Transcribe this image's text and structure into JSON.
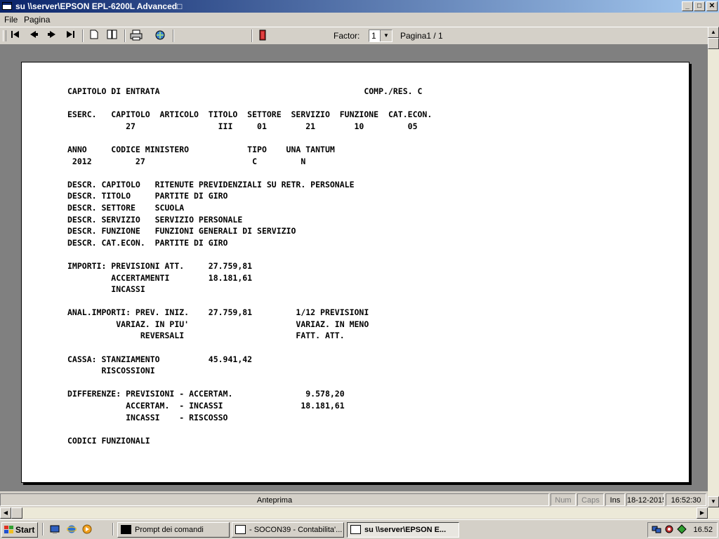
{
  "window": {
    "title": "su \\\\server\\EPSON EPL-6200L Advanced□",
    "minimize_glyph": "_",
    "maximize_glyph": "□",
    "close_glyph": "✕"
  },
  "menu": {
    "items": [
      "File",
      "Pagina"
    ]
  },
  "toolbar": {
    "factor_label": "Factor:",
    "factor_value": "1",
    "page_label": "Pagina1 / 1",
    "icons": [
      "first-page-icon",
      "prev-page-icon",
      "next-page-icon",
      "last-page-icon",
      "single-page-icon",
      "two-pages-icon",
      "print-icon",
      "export-icon",
      "exit-icon"
    ]
  },
  "report": {
    "lines": [
      "CAPITOLO DI ENTRATA                                          COMP./RES. C",
      "",
      "ESERC.   CAPITOLO  ARTICOLO  TITOLO  SETTORE  SERVIZIO  FUNZIONE  CAT.ECON.",
      "            27                 III     01        21        10         05",
      "",
      "ANNO     CODICE MINISTERO            TIPO    UNA TANTUM",
      " 2012         27                      C         N",
      "",
      "DESCR. CAPITOLO   RITENUTE PREVIDENZIALI SU RETR. PERSONALE",
      "DESCR. TITOLO     PARTITE DI GIRO",
      "DESCR. SETTORE    SCUOLA",
      "DESCR. SERVIZIO   SERVIZIO PERSONALE",
      "DESCR. FUNZIONE   FUNZIONI GENERALI DI SERVIZIO",
      "DESCR. CAT.ECON.  PARTITE DI GIRO",
      "",
      "IMPORTI: PREVISIONI ATT.     27.759,81",
      "         ACCERTAMENTI        18.181,61",
      "         INCASSI",
      "",
      "ANAL.IMPORTI: PREV. INIZ.    27.759,81         1/12 PREVISIONI",
      "          VARIAZ. IN PIU'                      VARIAZ. IN MENO",
      "               REVERSALI                       FATT. ATT.",
      "",
      "CASSA: STANZIAMENTO          45.941,42",
      "       RISCOSSIONI",
      "",
      "DIFFERENZE: PREVISIONI - ACCERTAM.               9.578,20",
      "            ACCERTAM.  - INCASSI                18.181,61",
      "            INCASSI    - RISCOSSO",
      "",
      "CODICI FUNZIONALI"
    ]
  },
  "statusbar": {
    "main": "Anteprima",
    "num": "Num",
    "caps": "Caps",
    "ins": "Ins",
    "date": "18-12-2015",
    "time": "16:52:30"
  },
  "taskbar": {
    "start_label": "Start",
    "tasks": [
      "Prompt dei comandi",
      "- SOCON39 - Contabilita'...",
      "su \\\\server\\EPSON E..."
    ],
    "clock": "16.52"
  },
  "colors": {
    "title_gradient_start": "#0a246a",
    "title_gradient_end": "#a6caf0",
    "chrome": "#d4d0c8",
    "viewport": "#808080"
  }
}
